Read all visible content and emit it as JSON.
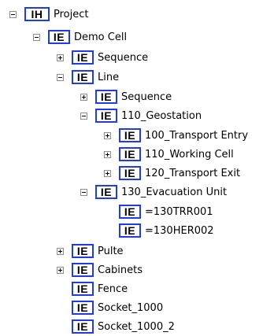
{
  "tree": {
    "nodes": [
      {
        "label": "Project",
        "badge": "IH",
        "toggle": "minus",
        "icon": "ih-badge-icon"
      },
      {
        "label": "Demo Cell",
        "badge": "IE",
        "toggle": "minus",
        "icon": "ie-badge-icon"
      },
      {
        "label": "Sequence",
        "badge": "IE",
        "toggle": "plus",
        "icon": "ie-badge-icon"
      },
      {
        "label": "Line",
        "badge": "IE",
        "toggle": "minus",
        "icon": "ie-badge-icon"
      },
      {
        "label": "Sequence",
        "badge": "IE",
        "toggle": "plus",
        "icon": "ie-badge-icon"
      },
      {
        "label": "110_Geostation",
        "badge": "IE",
        "toggle": "minus",
        "icon": "ie-badge-icon"
      },
      {
        "label": "100_Transport Entry",
        "badge": "IE",
        "toggle": "plus",
        "icon": "ie-badge-icon"
      },
      {
        "label": "110_Working Cell",
        "badge": "IE",
        "toggle": "plus",
        "icon": "ie-badge-icon"
      },
      {
        "label": "120_Transport Exit",
        "badge": "IE",
        "toggle": "plus",
        "icon": "ie-badge-icon"
      },
      {
        "label": "130_Evacuation Unit",
        "badge": "IE",
        "toggle": "minus",
        "icon": "ie-badge-icon"
      },
      {
        "label": "=130TRR001",
        "badge": "IE",
        "toggle": "none",
        "icon": "ie-badge-icon"
      },
      {
        "label": "=130HER002",
        "badge": "IE",
        "toggle": "none",
        "icon": "ie-badge-icon"
      },
      {
        "label": "Pulte",
        "badge": "IE",
        "toggle": "plus",
        "icon": "ie-badge-icon"
      },
      {
        "label": "Cabinets",
        "badge": "IE",
        "toggle": "plus",
        "icon": "ie-badge-icon"
      },
      {
        "label": "Fence",
        "badge": "IE",
        "toggle": "none",
        "icon": "ie-badge-icon"
      },
      {
        "label": "Socket_1000",
        "badge": "IE",
        "toggle": "none",
        "icon": "ie-badge-icon"
      },
      {
        "label": "Socket_1000_2",
        "badge": "IE",
        "toggle": "none",
        "icon": "ie-badge-icon"
      }
    ]
  },
  "colors": {
    "badge_border": "#1f3ce6",
    "toggle_border": "#8c8c8c",
    "background": "#ffffff"
  }
}
